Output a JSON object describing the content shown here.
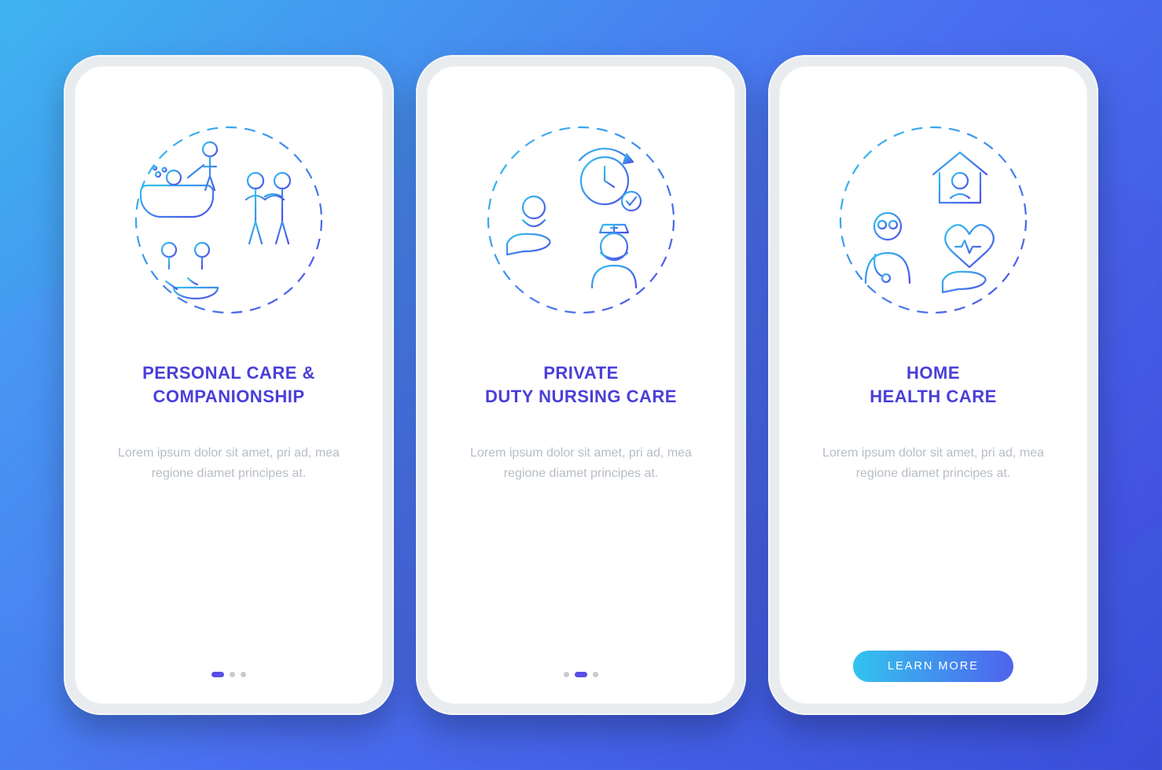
{
  "colors": {
    "title": "#4a3fd8",
    "grad_start": "#33c3ef",
    "grad_end": "#4f63ed",
    "desc": "#b7bdc6"
  },
  "screens": [
    {
      "title": "PERSONAL CARE &\nCOMPANIONSHIP",
      "description": "Lorem ipsum dolor sit amet, pri ad, mea regione diamet principes at.",
      "icon_name": "personal-care-icon",
      "active_dot": 0,
      "has_cta": false
    },
    {
      "title": "PRIVATE\nDUTY NURSING CARE",
      "description": "Lorem ipsum dolor sit amet, pri ad, mea regione diamet principes at.",
      "icon_name": "nursing-care-icon",
      "active_dot": 1,
      "has_cta": false
    },
    {
      "title": "HOME\nHEALTH CARE",
      "description": "Lorem ipsum dolor sit amet, pri ad, mea regione diamet principes at.",
      "icon_name": "home-health-icon",
      "active_dot": 2,
      "has_cta": true
    }
  ],
  "cta_label": "LEARN MORE",
  "dot_count": 3
}
